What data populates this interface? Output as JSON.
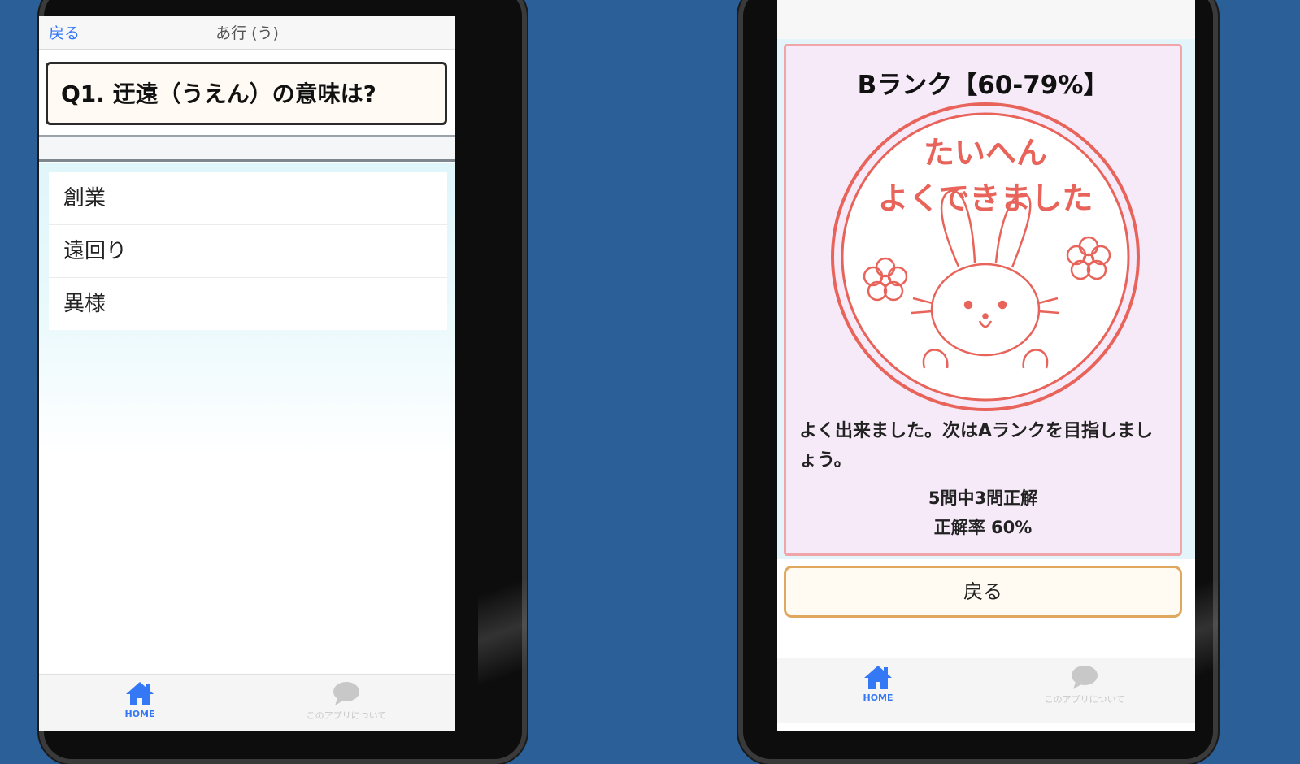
{
  "left_screen": {
    "nav": {
      "back": "戻る",
      "title": "あ行 (う)"
    },
    "question": "Q1. 迂遠（うえん）の意味は?",
    "answers": [
      "創業",
      "遠回り",
      "異様"
    ],
    "tabs": {
      "home": "HOME",
      "about": "このアプリについて"
    }
  },
  "right_screen": {
    "rank_title": "Bランク【60-79%】",
    "stamp": {
      "line1": "たいへん",
      "line2": "よくできました",
      "color": "#e8635a"
    },
    "message": "よく出来ました。次はAランクを目指しましょう。",
    "score_count": "5問中3問正解",
    "score_rate": "正解率 60%",
    "back_button": "戻る",
    "tabs": {
      "home": "HOME",
      "about": "このアプリについて"
    }
  },
  "colors": {
    "background": "#2a5f98",
    "accent": "#3478f6",
    "card_border": "#f0a5a9",
    "button_border": "#e0a85e"
  }
}
